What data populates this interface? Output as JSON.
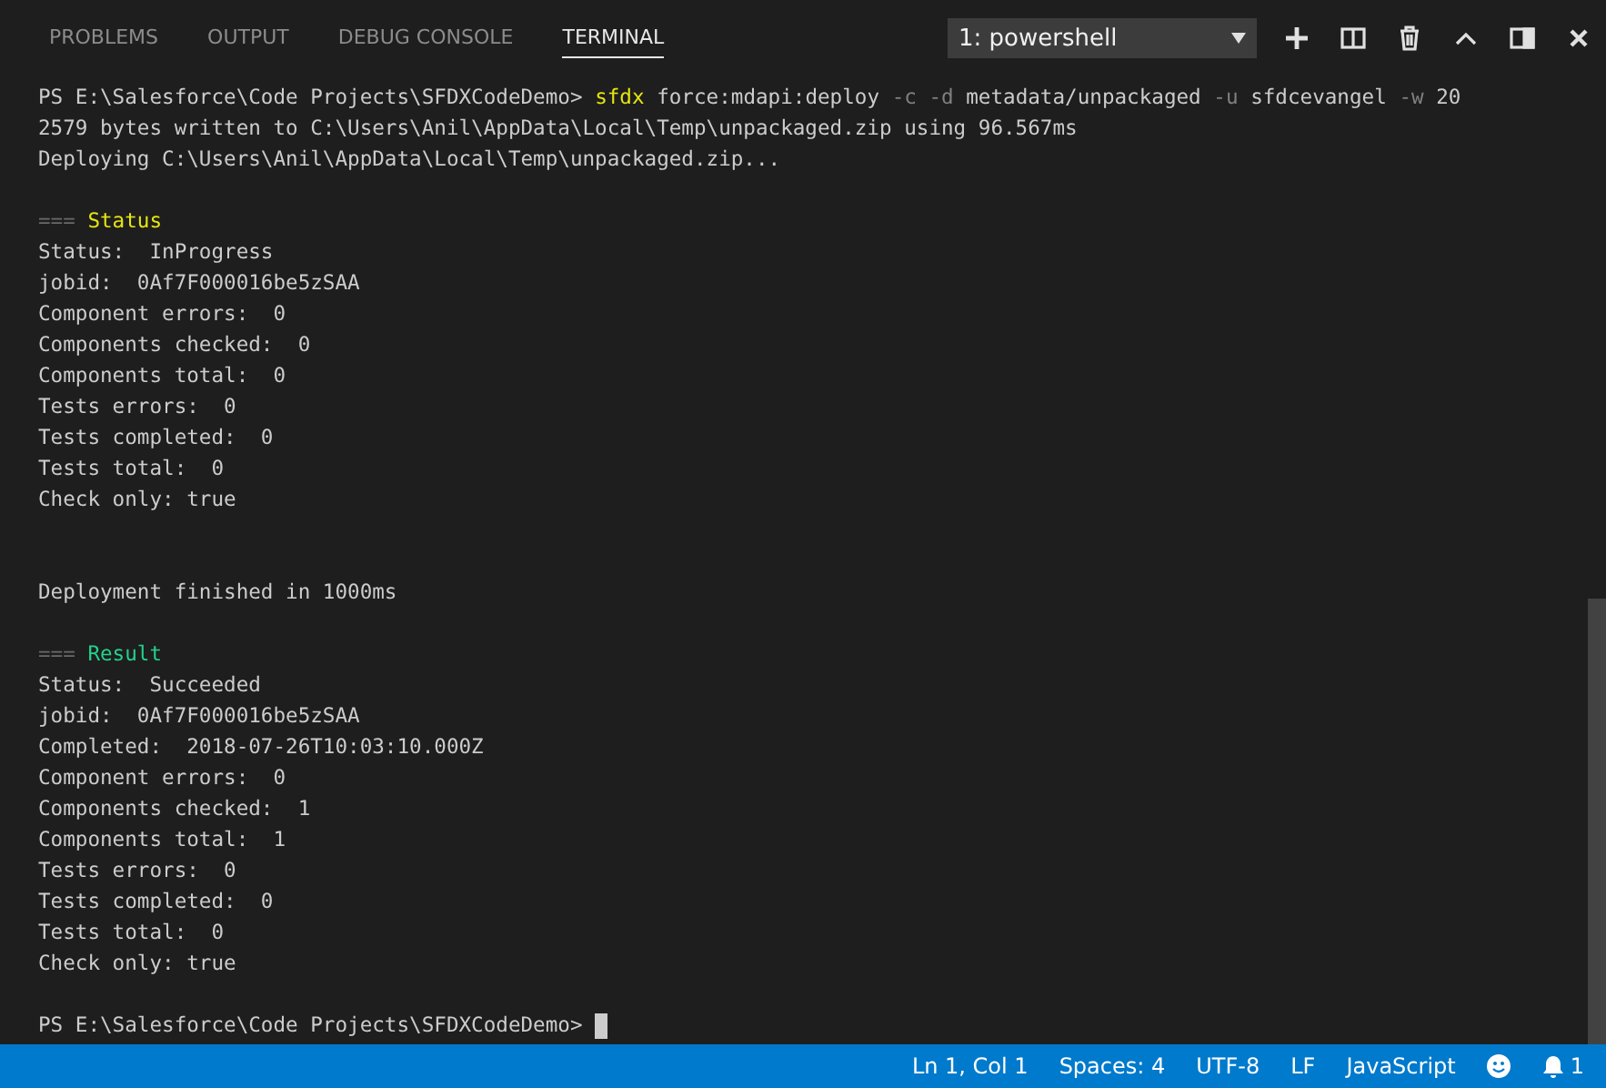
{
  "tabs": [
    {
      "label": "PROBLEMS",
      "selected": false
    },
    {
      "label": "OUTPUT",
      "selected": false
    },
    {
      "label": "DEBUG CONSOLE",
      "selected": false
    },
    {
      "label": "TERMINAL",
      "selected": true
    }
  ],
  "terminal_select": {
    "value": "1: powershell"
  },
  "terminal": [
    {
      "kind": "text",
      "segments": [
        {
          "text": "PS E:\\Salesforce\\Code Projects\\SFDXCodeDemo> ",
          "kind": "plain"
        },
        {
          "text": "sfdx",
          "kind": "command"
        },
        {
          "text": " force:mdapi:deploy ",
          "kind": "plain"
        },
        {
          "text": "-c -d",
          "kind": "flag"
        },
        {
          "text": " metadata/unpackaged ",
          "kind": "plain"
        },
        {
          "text": "-u",
          "kind": "flag"
        },
        {
          "text": " sfdcevangel ",
          "kind": "plain"
        },
        {
          "text": "-w",
          "kind": "flag"
        },
        {
          "text": " 20",
          "kind": "plain"
        }
      ]
    },
    {
      "kind": "text",
      "segments": [
        {
          "text": "2579 bytes written to C:\\Users\\Anil\\AppData\\Local\\Temp\\unpackaged.zip using 96.567ms",
          "kind": "plain"
        }
      ]
    },
    {
      "kind": "text",
      "segments": [
        {
          "text": "Deploying C:\\Users\\Anil\\AppData\\Local\\Temp\\unpackaged.zip...",
          "kind": "plain"
        }
      ]
    },
    {
      "kind": "blank"
    },
    {
      "kind": "text",
      "segments": [
        {
          "text": "===",
          "kind": "dim"
        },
        {
          "text": " Status",
          "kind": "heading-yellow"
        }
      ]
    },
    {
      "kind": "text",
      "segments": [
        {
          "text": "Status:  InProgress",
          "kind": "plain"
        }
      ]
    },
    {
      "kind": "text",
      "segments": [
        {
          "text": "jobid:  0Af7F000016be5zSAA",
          "kind": "plain"
        }
      ]
    },
    {
      "kind": "text",
      "segments": [
        {
          "text": "Component errors:  0",
          "kind": "plain"
        }
      ]
    },
    {
      "kind": "text",
      "segments": [
        {
          "text": "Components checked:  0",
          "kind": "plain"
        }
      ]
    },
    {
      "kind": "text",
      "segments": [
        {
          "text": "Components total:  0",
          "kind": "plain"
        }
      ]
    },
    {
      "kind": "text",
      "segments": [
        {
          "text": "Tests errors:  0",
          "kind": "plain"
        }
      ]
    },
    {
      "kind": "text",
      "segments": [
        {
          "text": "Tests completed:  0",
          "kind": "plain"
        }
      ]
    },
    {
      "kind": "text",
      "segments": [
        {
          "text": "Tests total:  0",
          "kind": "plain"
        }
      ]
    },
    {
      "kind": "text",
      "segments": [
        {
          "text": "Check only: true",
          "kind": "plain"
        }
      ]
    },
    {
      "kind": "blank"
    },
    {
      "kind": "blank"
    },
    {
      "kind": "text",
      "segments": [
        {
          "text": "Deployment finished in 1000ms",
          "kind": "plain"
        }
      ]
    },
    {
      "kind": "blank"
    },
    {
      "kind": "text",
      "segments": [
        {
          "text": "===",
          "kind": "dim"
        },
        {
          "text": " Result",
          "kind": "heading-green"
        }
      ]
    },
    {
      "kind": "text",
      "segments": [
        {
          "text": "Status:  Succeeded",
          "kind": "plain"
        }
      ]
    },
    {
      "kind": "text",
      "segments": [
        {
          "text": "jobid:  0Af7F000016be5zSAA",
          "kind": "plain"
        }
      ]
    },
    {
      "kind": "text",
      "segments": [
        {
          "text": "Completed:  2018-07-26T10:03:10.000Z",
          "kind": "plain"
        }
      ]
    },
    {
      "kind": "text",
      "segments": [
        {
          "text": "Component errors:  0",
          "kind": "plain"
        }
      ]
    },
    {
      "kind": "text",
      "segments": [
        {
          "text": "Components checked:  1",
          "kind": "plain"
        }
      ]
    },
    {
      "kind": "text",
      "segments": [
        {
          "text": "Components total:  1",
          "kind": "plain"
        }
      ]
    },
    {
      "kind": "text",
      "segments": [
        {
          "text": "Tests errors:  0",
          "kind": "plain"
        }
      ]
    },
    {
      "kind": "text",
      "segments": [
        {
          "text": "Tests completed:  0",
          "kind": "plain"
        }
      ]
    },
    {
      "kind": "text",
      "segments": [
        {
          "text": "Tests total:  0",
          "kind": "plain"
        }
      ]
    },
    {
      "kind": "text",
      "segments": [
        {
          "text": "Check only: true",
          "kind": "plain"
        }
      ]
    },
    {
      "kind": "blank"
    },
    {
      "kind": "text",
      "cursor": true,
      "segments": [
        {
          "text": "PS E:\\Salesforce\\Code Projects\\SFDXCodeDemo> ",
          "kind": "plain"
        }
      ]
    }
  ],
  "status_bar": {
    "items": [
      "Ln 1, Col 1",
      "Spaces: 4",
      "UTF-8",
      "LF",
      "JavaScript"
    ],
    "notifications": "1"
  }
}
